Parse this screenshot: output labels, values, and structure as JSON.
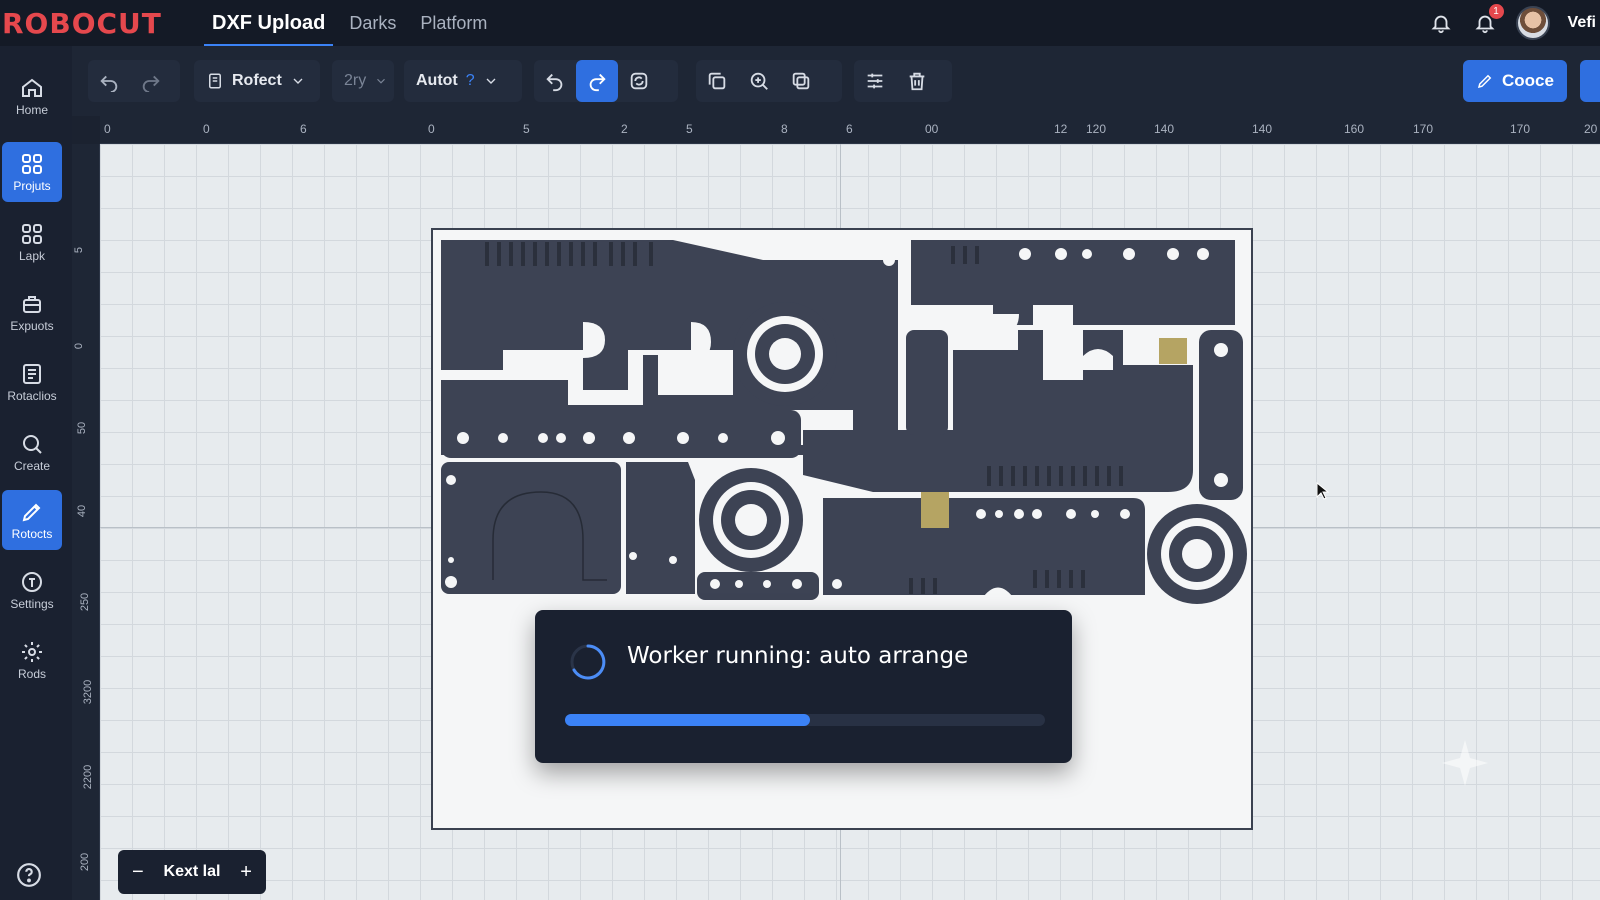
{
  "app": {
    "logo": "ROBOCUT",
    "user_name": "Vefi",
    "notification_count": "1"
  },
  "nav": {
    "tabs": [
      {
        "label": "DXF Upload",
        "active": true
      },
      {
        "label": "Darks"
      },
      {
        "label": "Platform"
      }
    ]
  },
  "sidebar": {
    "items": [
      {
        "label": "Home",
        "icon": "home-icon"
      },
      {
        "label": "Projuts",
        "icon": "grid-icon",
        "active": true
      },
      {
        "label": "Lapk",
        "icon": "grid-icon"
      },
      {
        "label": "Expuots",
        "icon": "export-icon"
      },
      {
        "label": "Rotaclios",
        "icon": "list-icon"
      },
      {
        "label": "Create",
        "icon": "search-icon"
      },
      {
        "label": "Rotocts",
        "icon": "pen-icon",
        "active": true
      },
      {
        "label": "Settings",
        "icon": "settings-icon"
      },
      {
        "label": "Rods",
        "icon": "gear-icon"
      }
    ],
    "help_icon": "help-icon"
  },
  "toolbar": {
    "profile_select": "Rofect",
    "zoom_select": "2ry",
    "mode_select": "Autot",
    "mode_hint": "?",
    "primary_label": "Cooce"
  },
  "ruler": {
    "top": [
      "0",
      "0",
      "6",
      "0",
      "5",
      "2",
      "5",
      "8",
      "6",
      "00",
      "12",
      "120",
      "140",
      "140",
      "160",
      "170",
      "170",
      "20"
    ],
    "left": [
      "5",
      "0",
      "50",
      "40",
      "250",
      "3200",
      "2200",
      "200"
    ]
  },
  "worker": {
    "title": "Worker running: auto arrange",
    "progress": 0.51
  },
  "zoom_control": {
    "label": "Kext lal",
    "minus": "−",
    "plus": "+"
  },
  "colors": {
    "accent": "#2f6fe0",
    "brand": "#e5484d",
    "part": "#3d4354",
    "panel": "#1a2130"
  }
}
